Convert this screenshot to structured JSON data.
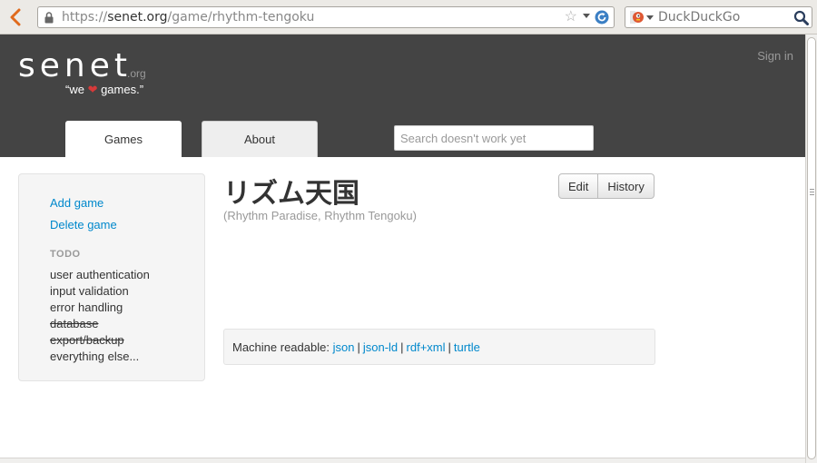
{
  "browser": {
    "url_prefix": "https://",
    "url_host": "senet.org",
    "url_path": "/game/rhythm-tengoku",
    "search_engine": "DuckDuckGo"
  },
  "header": {
    "logo": "senet",
    "logo_tld": ".org",
    "tagline_before": "“we ",
    "tagline_heart": "❤",
    "tagline_after": " games.”",
    "signin": "Sign in",
    "tabs": [
      {
        "label": "Games",
        "active": true
      },
      {
        "label": "About",
        "active": false
      }
    ],
    "search_placeholder": "Search doesn't work yet"
  },
  "sidebar": {
    "add_game": "Add game",
    "delete_game": "Delete game",
    "todo_heading": "TODO",
    "todo_items": [
      {
        "label": "user authentication",
        "done": false
      },
      {
        "label": "input validation",
        "done": false
      },
      {
        "label": "error handling",
        "done": false
      },
      {
        "label": "database",
        "done": true
      },
      {
        "label": "export/backup",
        "done": true
      },
      {
        "label": "everything else...",
        "done": false
      }
    ]
  },
  "game": {
    "title": "リズム天国",
    "subtitle": "(Rhythm Paradise, Rhythm Tengoku)",
    "edit_label": "Edit",
    "history_label": "History"
  },
  "machine_readable": {
    "label": "Machine readable:",
    "formats": [
      "json",
      "json-ld",
      "rdf+xml",
      "turtle"
    ],
    "separator": "|"
  },
  "colors": {
    "header_bg": "#444444",
    "link": "#0088cc",
    "heart": "#d63a3a"
  }
}
